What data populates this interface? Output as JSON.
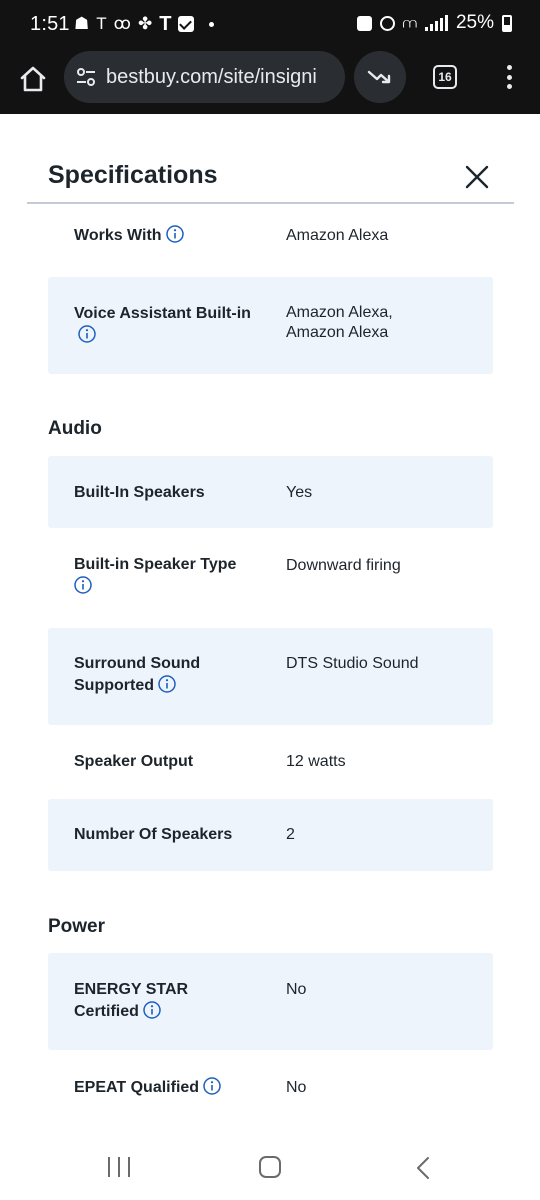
{
  "status_bar": {
    "time": "1:51",
    "battery": "25%"
  },
  "browser": {
    "url": "bestbuy.com/site/insigni",
    "tab_count": "16"
  },
  "modal": {
    "title": "Specifications"
  },
  "specs": {
    "works_with": {
      "label": "Works With",
      "value": "Amazon Alexa"
    },
    "voice_assistant": {
      "label": "Voice Assistant Built-in",
      "value": "Amazon Alexa, Amazon Alexa"
    },
    "audio": {
      "title": "Audio",
      "built_in_speakers": {
        "label": "Built-In Speakers",
        "value": "Yes"
      },
      "speaker_type": {
        "label": "Built-in Speaker Type",
        "value": "Downward firing"
      },
      "surround_sound": {
        "label": "Surround Sound Supported",
        "value": "DTS Studio Sound"
      },
      "speaker_output": {
        "label": "Speaker Output",
        "value": "12 watts"
      },
      "number_of_speakers": {
        "label": "Number Of Speakers",
        "value": "2"
      }
    },
    "power": {
      "title": "Power",
      "energy_star": {
        "label": "ENERGY STAR Certified",
        "value": "No"
      },
      "epeat": {
        "label": "EPEAT Qualified",
        "value": "No"
      }
    }
  },
  "colors": {
    "row_shade": "#eef4fc",
    "info_icon": "#1d5fbf",
    "text": "#1d252c"
  }
}
